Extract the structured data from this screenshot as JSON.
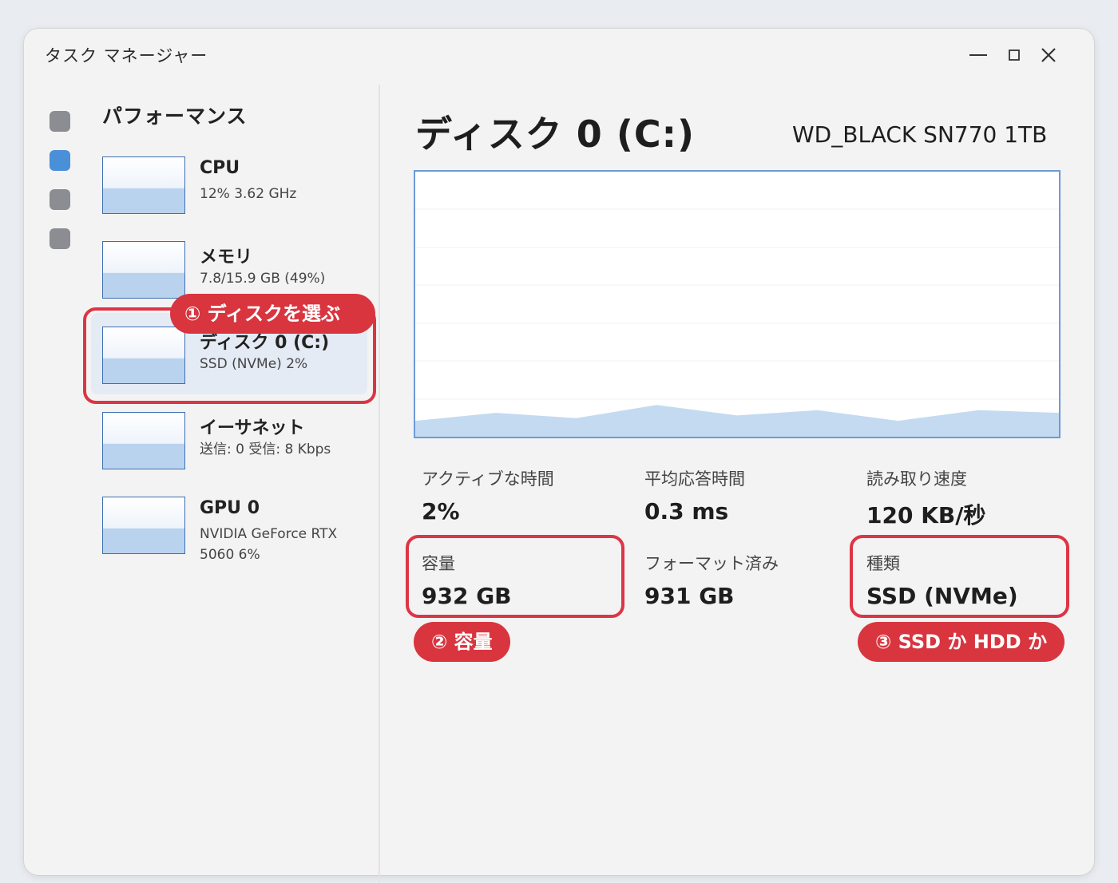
{
  "window": {
    "title": "タスク マネージャー"
  },
  "controls": {
    "minimize": "minimize-icon",
    "maximize": "maximize-icon",
    "close": "close-icon"
  },
  "sidebar": {
    "section_title": "パフォーマンス",
    "items": [
      {
        "name": "CPU",
        "sub": "12% 3.62 GHz"
      },
      {
        "name": "メモリ",
        "sub": "7.8/15.9 GB (49%)"
      },
      {
        "name": "ディスク 0 (C:)",
        "sub": "SSD (NVMe) 2%",
        "selected": true
      },
      {
        "name": "イーサネット",
        "sub": "送信: 0 受信: 8 Kbps"
      },
      {
        "name": "GPU 0",
        "sub": "NVIDIA GeForce RTX",
        "sub2": "5060 6%"
      }
    ]
  },
  "disk": {
    "title": "ディスク 0 (C:)",
    "model": "WD_BLACK SN770 1TB",
    "activity": [
      6,
      9,
      7,
      12,
      8,
      10,
      6,
      10,
      9
    ]
  },
  "stats": {
    "active_time": {
      "label": "アクティブな時間",
      "value": "2%"
    },
    "avg_response": {
      "label": "平均応答時間",
      "value": "0.3 ms"
    },
    "read_speed": {
      "label": "読み取り速度",
      "value": "120 KB/秒"
    },
    "capacity": {
      "label": "容量",
      "value": "932 GB"
    },
    "formatted": {
      "label": "フォーマット済み",
      "value": "931 GB"
    },
    "type": {
      "label": "種類",
      "value": "SSD (NVMe)"
    }
  },
  "callouts": {
    "c1": "① ディスクを選ぶ",
    "c2": "② 容量",
    "c3": "③ SSD か HDD か"
  },
  "colors": {
    "accent": "#4a90d9",
    "highlight": "#dc3545",
    "graph_fill": "#b9d3ef"
  }
}
